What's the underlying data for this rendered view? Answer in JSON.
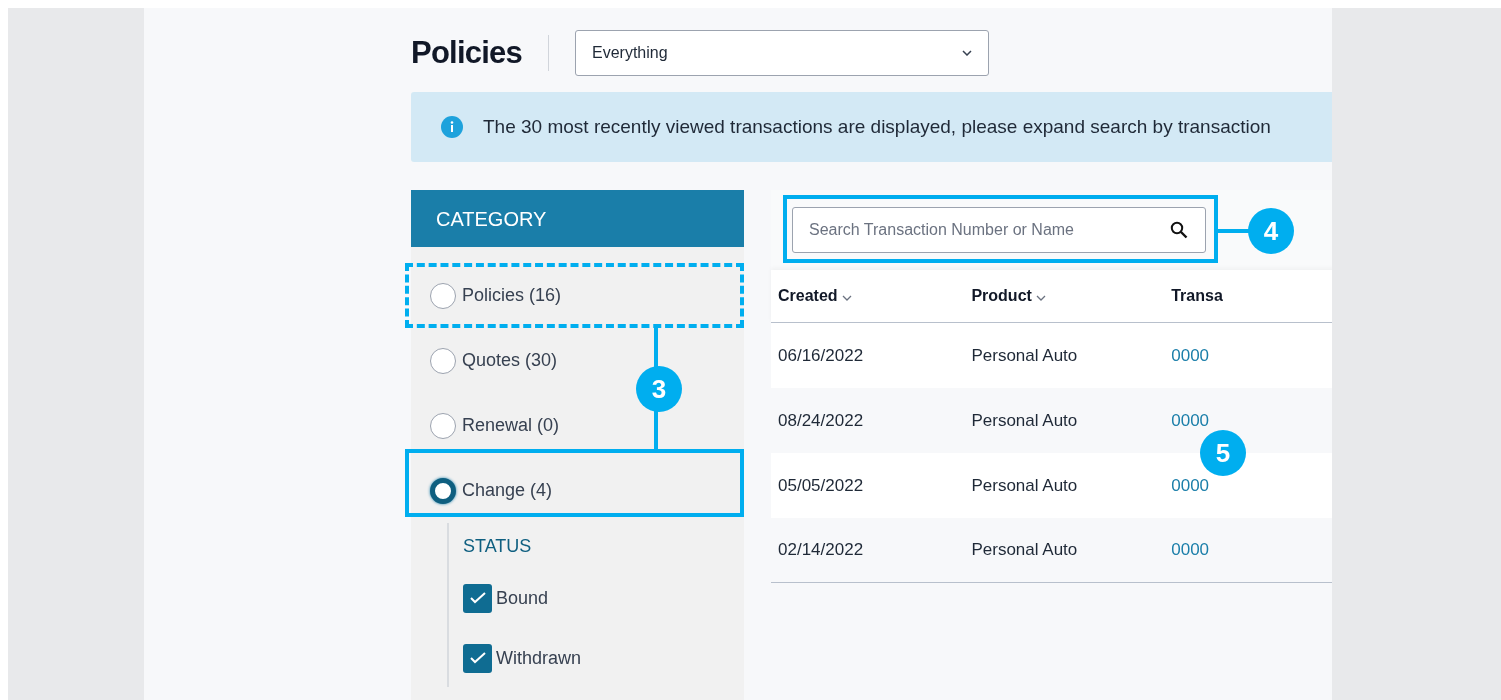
{
  "page": {
    "title": "Policies",
    "filter": {
      "value": "Everything"
    }
  },
  "banner": {
    "text": "The 30 most recently viewed transactions are displayed, please expand search by transaction"
  },
  "sidebar": {
    "header": "CATEGORY",
    "categories": [
      {
        "label": "Policies (16)",
        "selected": false
      },
      {
        "label": "Quotes (30)",
        "selected": false
      },
      {
        "label": "Renewal (0)",
        "selected": false
      },
      {
        "label": "Change (4)",
        "selected": true
      }
    ],
    "status": {
      "title": "STATUS",
      "options": [
        {
          "label": "Bound",
          "checked": true
        },
        {
          "label": "Withdrawn",
          "checked": true
        }
      ]
    }
  },
  "search": {
    "placeholder": "Search Transaction Number or Name"
  },
  "table": {
    "columns": [
      {
        "label": "Created",
        "sortable": true
      },
      {
        "label": "Product",
        "sortable": true
      },
      {
        "label": "Transa",
        "sortable": false
      }
    ],
    "rows": [
      [
        "06/16/2022",
        "Personal Auto",
        "0000"
      ],
      [
        "08/24/2022",
        "Personal Auto",
        "0000"
      ],
      [
        "05/05/2022",
        "Personal Auto",
        "0000"
      ],
      [
        "02/14/2022",
        "Personal Auto",
        "0000"
      ]
    ]
  },
  "callouts": [
    {
      "number": "3",
      "kind": "bracket"
    },
    {
      "number": "4",
      "kind": "box"
    },
    {
      "number": "5",
      "kind": "badge"
    }
  ]
}
